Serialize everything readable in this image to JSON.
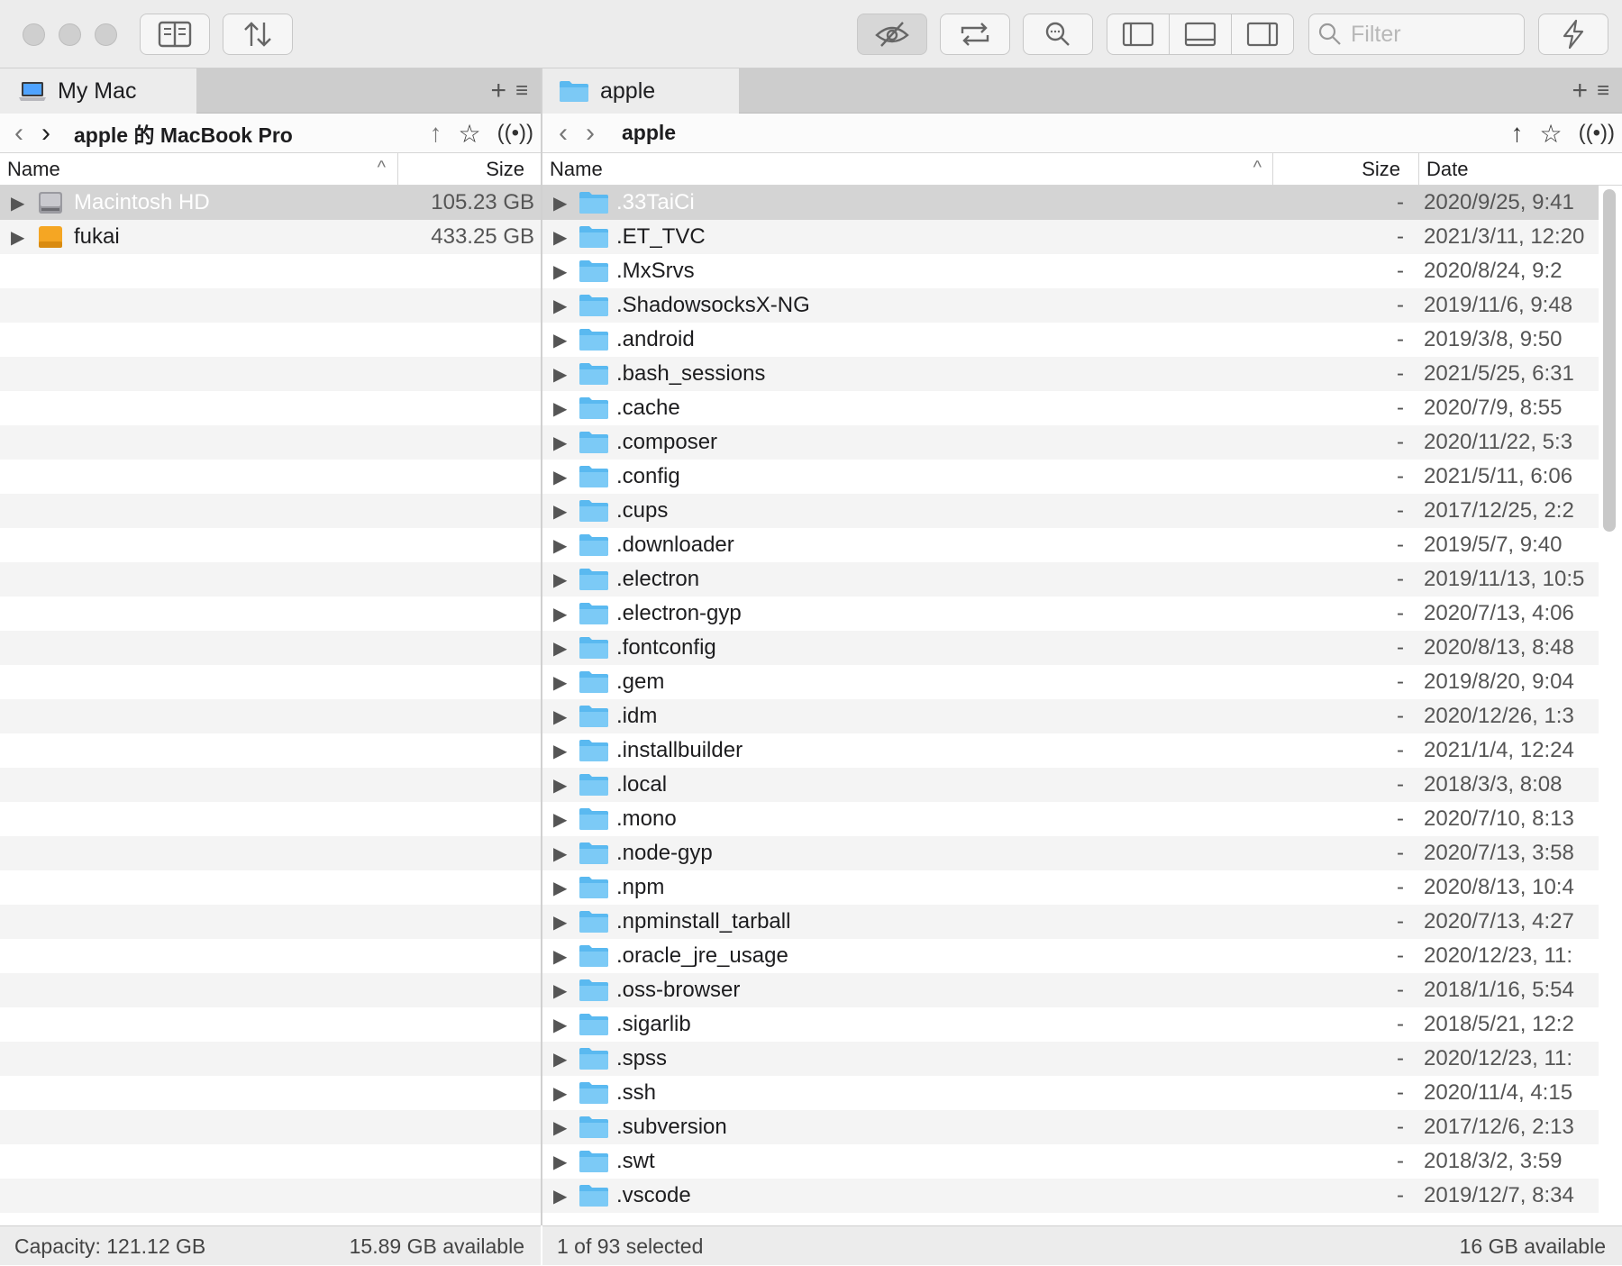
{
  "toolbar": {
    "filter_placeholder": "Filter",
    "icons": [
      "panel-icon",
      "sort-icon",
      "hidden-icon",
      "sync-icon",
      "search-icon",
      "layout-left-icon",
      "layout-bottom-icon",
      "layout-right-icon",
      "bolt-icon"
    ]
  },
  "left": {
    "tab_label": "My Mac",
    "path_title": "apple 的 MacBook Pro",
    "columns": {
      "name": "Name",
      "size": "Size"
    },
    "rows": [
      {
        "name": "Macintosh HD",
        "size": "105.23 GB",
        "icon": "hard-drive-icon",
        "selected": true
      },
      {
        "name": "fukai",
        "size": "433.25 GB",
        "icon": "external-drive-icon",
        "selected": false
      }
    ],
    "status": {
      "capacity": "Capacity: 121.12 GB",
      "available": "15.89 GB available"
    }
  },
  "right": {
    "tab_label": "apple",
    "path_title": "apple",
    "columns": {
      "name": "Name",
      "size": "Size",
      "date": "Date"
    },
    "rows": [
      {
        "name": ".33TaiCi",
        "size": "-",
        "date": "2020/9/25, 9:41",
        "selected": true
      },
      {
        "name": ".ET_TVC",
        "size": "-",
        "date": "2021/3/11, 12:20"
      },
      {
        "name": ".MxSrvs",
        "size": "-",
        "date": "2020/8/24, 9:2"
      },
      {
        "name": ".ShadowsocksX-NG",
        "size": "-",
        "date": "2019/11/6, 9:48"
      },
      {
        "name": ".android",
        "size": "-",
        "date": "2019/3/8, 9:50"
      },
      {
        "name": ".bash_sessions",
        "size": "-",
        "date": "2021/5/25, 6:31"
      },
      {
        "name": ".cache",
        "size": "-",
        "date": "2020/7/9, 8:55"
      },
      {
        "name": ".composer",
        "size": "-",
        "date": "2020/11/22, 5:3"
      },
      {
        "name": ".config",
        "size": "-",
        "date": "2021/5/11, 6:06"
      },
      {
        "name": ".cups",
        "size": "-",
        "date": "2017/12/25, 2:2"
      },
      {
        "name": ".downloader",
        "size": "-",
        "date": "2019/5/7, 9:40"
      },
      {
        "name": ".electron",
        "size": "-",
        "date": "2019/11/13, 10:5"
      },
      {
        "name": ".electron-gyp",
        "size": "-",
        "date": "2020/7/13, 4:06"
      },
      {
        "name": ".fontconfig",
        "size": "-",
        "date": "2020/8/13, 8:48"
      },
      {
        "name": ".gem",
        "size": "-",
        "date": "2019/8/20, 9:04"
      },
      {
        "name": ".idm",
        "size": "-",
        "date": "2020/12/26, 1:3"
      },
      {
        "name": ".installbuilder",
        "size": "-",
        "date": "2021/1/4, 12:24"
      },
      {
        "name": ".local",
        "size": "-",
        "date": "2018/3/3, 8:08"
      },
      {
        "name": ".mono",
        "size": "-",
        "date": "2020/7/10, 8:13"
      },
      {
        "name": ".node-gyp",
        "size": "-",
        "date": "2020/7/13, 3:58"
      },
      {
        "name": ".npm",
        "size": "-",
        "date": "2020/8/13, 10:4"
      },
      {
        "name": ".npminstall_tarball",
        "size": "-",
        "date": "2020/7/13, 4:27"
      },
      {
        "name": ".oracle_jre_usage",
        "size": "-",
        "date": "2020/12/23, 11:"
      },
      {
        "name": ".oss-browser",
        "size": "-",
        "date": "2018/1/16, 5:54"
      },
      {
        "name": ".sigarlib",
        "size": "-",
        "date": "2018/5/21, 12:2"
      },
      {
        "name": ".spss",
        "size": "-",
        "date": "2020/12/23, 11:"
      },
      {
        "name": ".ssh",
        "size": "-",
        "date": "2020/11/4, 4:15"
      },
      {
        "name": ".subversion",
        "size": "-",
        "date": "2017/12/6, 2:13"
      },
      {
        "name": ".swt",
        "size": "-",
        "date": "2018/3/2, 3:59"
      },
      {
        "name": ".vscode",
        "size": "-",
        "date": "2019/12/7, 8:34"
      }
    ],
    "status": {
      "selection": "1 of 93 selected",
      "available": "16 GB available"
    }
  },
  "colors": {
    "folder": "#5ab9f0",
    "selection": "#d4d4d4",
    "alt_row": "#f4f4f4"
  }
}
